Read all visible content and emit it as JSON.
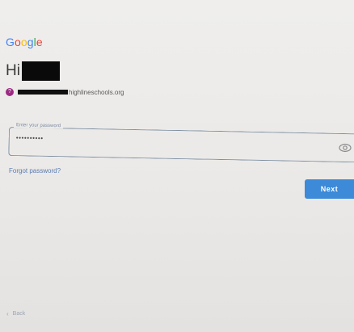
{
  "brand": {
    "letters": [
      "G",
      "o",
      "o",
      "g",
      "l",
      "e"
    ]
  },
  "greeting": {
    "prefix": "Hi"
  },
  "account": {
    "avatar_letter": "?",
    "email_domain": "highlineschools.org"
  },
  "password": {
    "label": "Enter your password",
    "masked_value": "••••••••••"
  },
  "links": {
    "forgot_password": "Forgot password?"
  },
  "buttons": {
    "next_label": "Next",
    "back_label": "Back"
  },
  "colors": {
    "accent": "#3c8ad8",
    "avatar": "#9c2a83",
    "field_border": "#7d8fa3",
    "background": "#ebe9e7"
  }
}
